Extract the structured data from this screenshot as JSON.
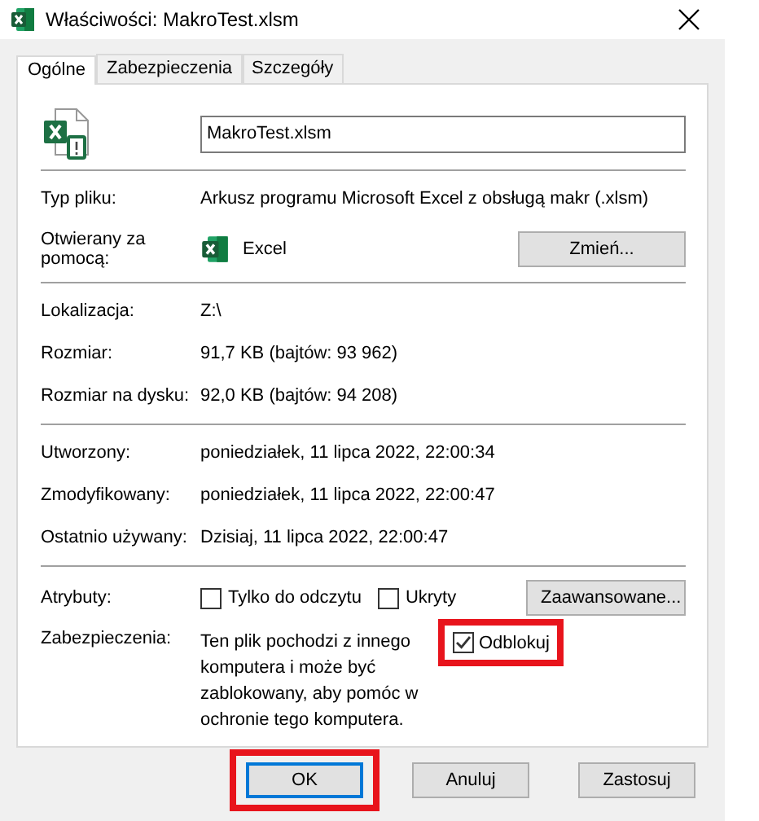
{
  "window": {
    "title": "Właściwości: MakroTest.xlsm"
  },
  "tabs": [
    {
      "label": "Ogólne",
      "selected": true
    },
    {
      "label": "Zabezpieczenia",
      "selected": false
    },
    {
      "label": "Szczegóły",
      "selected": false
    }
  ],
  "file_name": "MakroTest.xlsm",
  "file_type": {
    "label": "Typ pliku:",
    "value": "Arkusz programu Microsoft Excel z obsługą makr (.xlsm)"
  },
  "opens_with": {
    "label": "Otwierany za pomocą:",
    "app": "Excel",
    "button": "Zmień..."
  },
  "groups": [
    [
      {
        "label": "Lokalizacja:",
        "value": "Z:\\"
      },
      {
        "label": "Rozmiar:",
        "value": "91,7 KB (bajtów: 93 962)"
      },
      {
        "label": "Rozmiar na dysku:",
        "value": "92,0 KB (bajtów: 94 208)"
      }
    ],
    [
      {
        "label": "Utworzony:",
        "value": "poniedziałek, 11 lipca 2022, 22:00:34"
      },
      {
        "label": "Zmodyfikowany:",
        "value": "poniedziałek, 11 lipca 2022, 22:00:47"
      },
      {
        "label": "Ostatnio używany:",
        "value": "Dzisiaj, 11 lipca 2022, 22:00:47"
      }
    ]
  ],
  "attributes": {
    "label": "Atrybuty:",
    "checkboxes": [
      {
        "label": "Tylko do odczytu",
        "checked": false
      },
      {
        "label": "Ukryty",
        "checked": false
      }
    ],
    "button": "Zaawansowane..."
  },
  "security": {
    "label": "Zabezpieczenia:",
    "text": "Ten plik pochodzi z innego komputera i może być zablokowany, aby pomóc w ochronie tego komputera.",
    "checkbox": {
      "label": "Odblokuj",
      "checked": true,
      "highlighted": true
    }
  },
  "buttons": [
    {
      "label": "OK",
      "default": true,
      "highlighted": true
    },
    {
      "label": "Anuluj",
      "default": false,
      "highlighted": false
    },
    {
      "label": "Zastosuj",
      "default": false,
      "highlighted": false
    }
  ]
}
